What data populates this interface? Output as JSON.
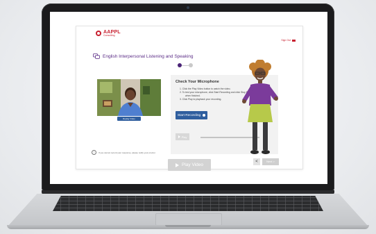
{
  "brand": {
    "name": "AAPPL",
    "subtitle": "Consulting"
  },
  "header": {
    "signout_label": "Sign Out"
  },
  "activity": {
    "title": "English Interpersonal Listening and Speaking"
  },
  "video": {
    "replay_label": "Replay Video"
  },
  "mic_check": {
    "title": "Check Your Microphone",
    "steps": [
      "1. Click the Play Video button to watch the video.",
      "2. To test your microphone, click Start Recording and click Stop Recording",
      "when finished.",
      "3. Click Play to playback your recording."
    ],
    "start_label": "Start Recording",
    "play_label": "Play"
  },
  "footer": {
    "info_text": "If you cannot record your response, please notify your proctor.",
    "back_label": "<",
    "next_label": "Next >"
  },
  "cta": {
    "play_video_label": "Play Video"
  },
  "colors": {
    "brand_red": "#c8202f",
    "accent_purple": "#5b2c86",
    "button_blue": "#2f5e9e"
  }
}
